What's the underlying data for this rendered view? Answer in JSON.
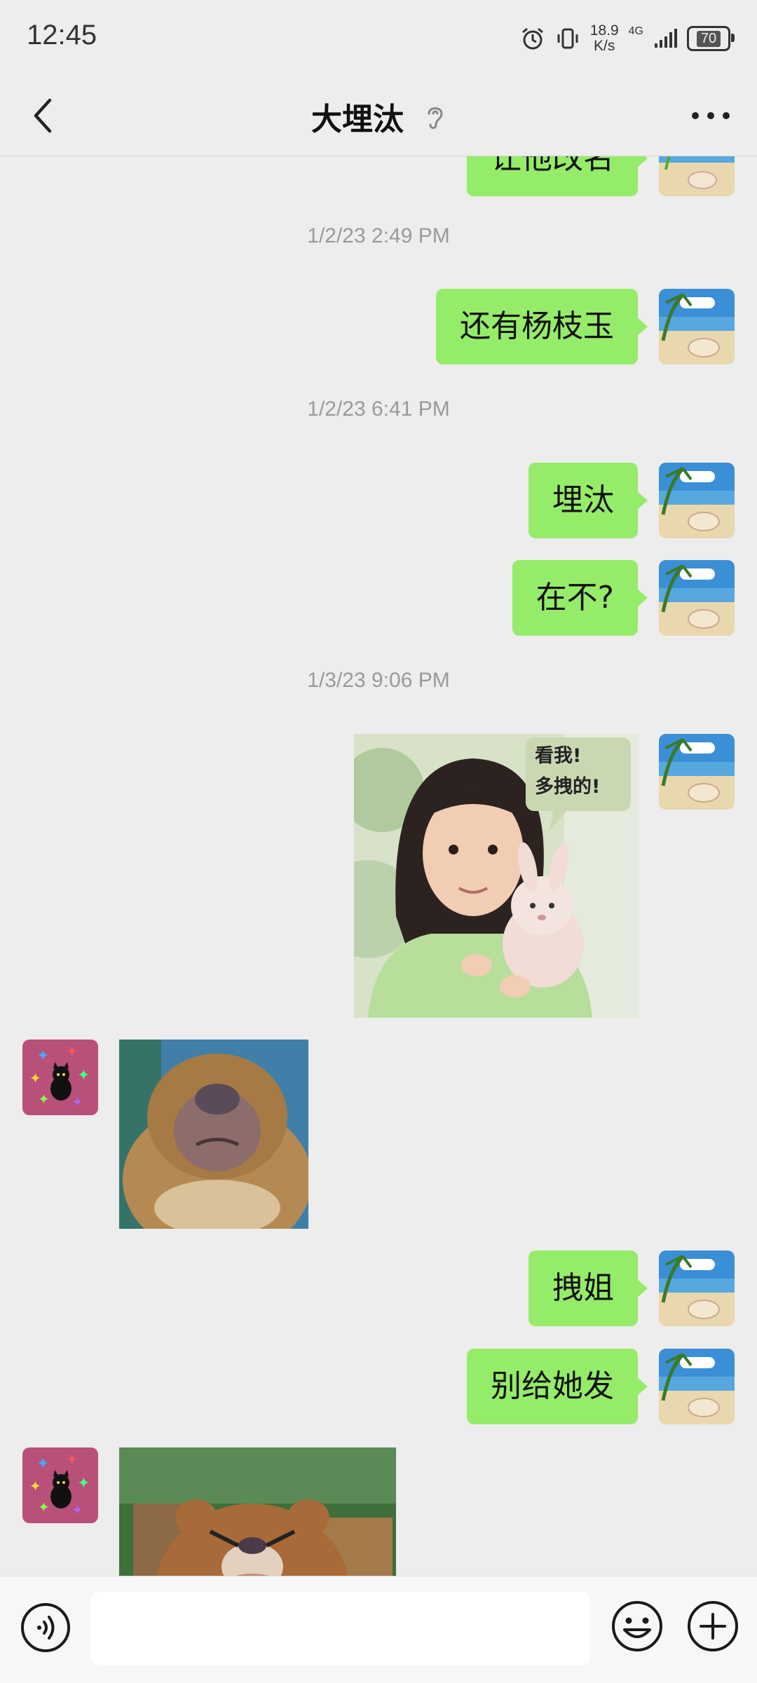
{
  "status_bar": {
    "time": "12:45",
    "net_speed_value": "18.9",
    "net_speed_unit": "K/s",
    "signal_label": "4G",
    "battery": "70"
  },
  "header": {
    "title": "大埋汰"
  },
  "messages": {
    "partial_top": "让他改名",
    "ts1": "1/2/23 2:49 PM",
    "m1": "还有杨枝玉",
    "ts2": "1/2/23 6:41 PM",
    "m2": "埋汰",
    "m3": "在不?",
    "ts3": "1/3/23 9:06 PM",
    "sticker_caption_line1": "看我!",
    "sticker_caption_line2": "多拽的!",
    "m4": "拽姐",
    "m5": "别给她发"
  },
  "input": {
    "placeholder": ""
  },
  "colors": {
    "background": "#ededed",
    "bubble_green": "#95ec69",
    "timestamp_gray": "#9a9a9a"
  }
}
